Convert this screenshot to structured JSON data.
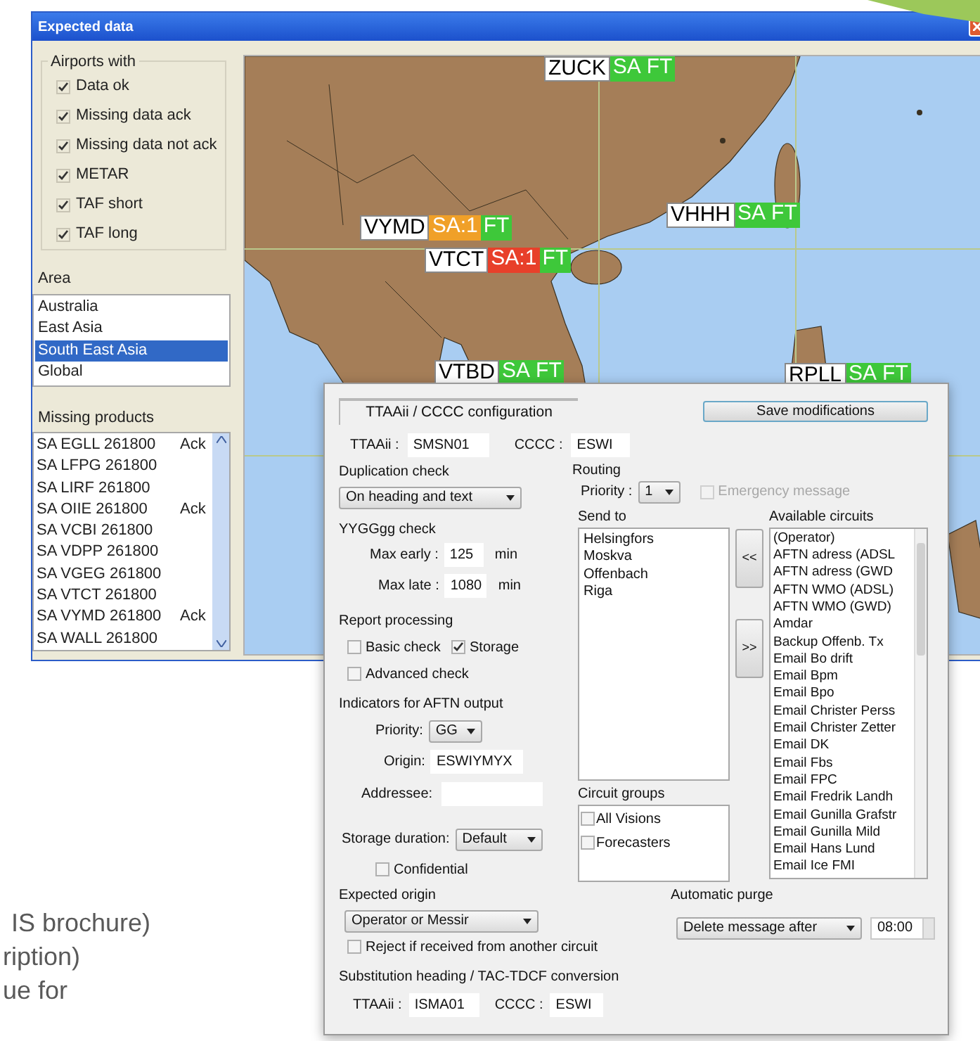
{
  "window": {
    "title": "Expected data"
  },
  "filters": {
    "title": "Airports with",
    "items": [
      {
        "label": "Data ok",
        "checked": true
      },
      {
        "label": "Missing data ack",
        "checked": true
      },
      {
        "label": "Missing data not ack",
        "checked": true
      },
      {
        "label": "METAR",
        "checked": true
      },
      {
        "label": "TAF short",
        "checked": true
      },
      {
        "label": "TAF long",
        "checked": true
      }
    ]
  },
  "area": {
    "title": "Area",
    "items": [
      {
        "label": "Australia",
        "selected": false
      },
      {
        "label": "East Asia",
        "selected": false
      },
      {
        "label": "South East Asia",
        "selected": true
      },
      {
        "label": "Global",
        "selected": false
      }
    ]
  },
  "missing_products": {
    "title": "Missing products",
    "rows": [
      {
        "product": "SA EGLL 261800",
        "status": "Ack"
      },
      {
        "product": "SA LFPG 261800"
      },
      {
        "product": "SA LIRF 261800"
      },
      {
        "product": "SA OIIE 261800",
        "status": "Ack"
      },
      {
        "product": "SA VCBI 261800"
      },
      {
        "product": "SA VDPP 261800"
      },
      {
        "product": "SA VGEG 261800"
      },
      {
        "product": "SA VTCT 261800"
      },
      {
        "product": "SA VYMD 261800",
        "status": "Ack"
      },
      {
        "product": "SA WALL 261800"
      }
    ]
  },
  "map": {
    "stations": [
      {
        "code": "ZUCK",
        "products": [
          {
            "text": "SA",
            "color": "#3ec83a"
          },
          {
            "text": "FT",
            "color": "#3ec83a"
          }
        ]
      },
      {
        "code": "VYMD",
        "products": [
          {
            "text": "SA:1",
            "color": "#f0a028"
          },
          {
            "text": "FT",
            "color": "#3ec83a"
          }
        ]
      },
      {
        "code": "VHHH",
        "products": [
          {
            "text": "SA",
            "color": "#3ec83a"
          },
          {
            "text": "FT",
            "color": "#3ec83a"
          }
        ]
      },
      {
        "code": "VTCT",
        "products": [
          {
            "text": "SA:1",
            "color": "#e8402a"
          },
          {
            "text": "FT",
            "color": "#3ec83a"
          }
        ]
      },
      {
        "code": "VTBD",
        "products": [
          {
            "text": "SA",
            "color": "#3ec83a"
          },
          {
            "text": "FT",
            "color": "#3ec83a"
          }
        ]
      },
      {
        "code": "RPLL",
        "products": [
          {
            "text": "SA",
            "color": "#3ec83a"
          },
          {
            "text": "FT",
            "color": "#3ec83a"
          }
        ]
      }
    ]
  },
  "config": {
    "title": "TTAAii / CCCC configuration",
    "save_button": "Save modifications",
    "heading": {
      "ttaaii_label": "TTAAii :",
      "ttaaii": "SMSN01",
      "cccc_label": "CCCC :",
      "cccc": "ESWI"
    },
    "duplication_check": {
      "label": "Duplication check",
      "value": "On heading and text"
    },
    "yygggg_check": {
      "label": "YYGGgg check",
      "max_early_label": "Max early :",
      "max_early": "125",
      "max_early_unit": "min",
      "max_late_label": "Max late :",
      "max_late": "1080",
      "max_late_unit": "min"
    },
    "report_processing": {
      "label": "Report processing",
      "options": [
        {
          "label": "Basic check",
          "checked": false
        },
        {
          "label": "Storage",
          "checked": true
        },
        {
          "label": "Advanced check",
          "checked": false
        }
      ]
    },
    "aftn_output": {
      "label": "Indicators for AFTN output",
      "priority_label": "Priority:",
      "priority": "GG",
      "origin_label": "Origin:",
      "origin": "ESWIYMYX",
      "addressee_label": "Addressee:"
    },
    "storage_duration": {
      "label": "Storage duration:",
      "value": "Default"
    },
    "confidential": {
      "label": "Confidential",
      "checked": false
    },
    "routing": {
      "label": "Routing",
      "priority_label": "Priority :",
      "priority": "1",
      "emergency": {
        "label": "Emergency message",
        "checked": false,
        "disabled": true
      },
      "send_to_label": "Send to",
      "send_to": [
        "Helsingfors",
        "Moskva",
        "Offenbach",
        "Riga"
      ],
      "add_button": "<<",
      "remove_button": ">>",
      "circuit_groups_label": "Circuit groups",
      "circuit_groups": [
        {
          "label": "All Visions",
          "checked": false
        },
        {
          "label": "Forecasters",
          "checked": false
        }
      ],
      "available_label": "Available circuits",
      "available": [
        "(Operator)",
        "AFTN adress (ADSL",
        "AFTN adress (GWD",
        "AFTN WMO (ADSL)",
        "AFTN WMO (GWD)",
        "Amdar",
        "Backup Offenb. Tx",
        "Email Bo drift",
        "Email Bpm",
        "Email Bpo",
        "Email Christer Perss",
        "Email Christer Zetter",
        "Email DK",
        "Email Fbs",
        "Email FPC",
        "Email Fredrik Landh",
        "Email Gunilla Grafstr",
        "Email Gunilla Mild",
        "Email Hans Lund",
        "Email Ice FMI"
      ]
    },
    "expected_origin": {
      "label": "Expected origin",
      "value": "Operator or Messir",
      "reject": {
        "label": "Reject if received from another circuit",
        "checked": false
      }
    },
    "substitution": {
      "label": "Substitution heading / TAC-TDCF conversion",
      "ttaaii_label": "TTAAii :",
      "ttaaii": "ISMA01",
      "cccc_label": "CCCC :",
      "cccc": "ESWI"
    },
    "automatic_purge": {
      "label": "Automatic purge",
      "action": "Delete message after",
      "time": "08:00"
    }
  },
  "slide_text": [
    "IS brochure)",
    "ription)",
    "ue for"
  ]
}
